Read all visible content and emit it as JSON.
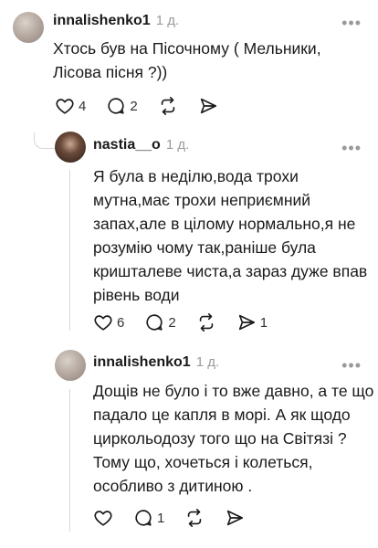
{
  "comments": [
    {
      "user": "innalishenko1",
      "time": "1 д.",
      "text_lines": [
        "Хтось був на Пісочному ( Мельники,",
        "Лісова пісня ?))"
      ],
      "likes": "4",
      "replies": "2",
      "shares": ""
    },
    {
      "user": "nastia__o",
      "time": "1 д.",
      "text_lines": [
        "Я була в неділю,вода трохи",
        "мутна,має трохи неприємний",
        "запах,але в цілому нормально,я не",
        "розумію чому так,раніше була",
        "кришталеве чиста,а зараз дуже впав",
        "рівень води"
      ],
      "likes": "6",
      "replies": "2",
      "shares": "1"
    },
    {
      "user": "innalishenko1",
      "time": "1 д.",
      "text_lines": [
        "Дощів не було і то вже давно, а те що",
        "падало це капля в морі. А як щодо",
        "циркольодозу того що на Світязі ?",
        "Тому що, хочеться і колеться,",
        "особливо з дитиною ."
      ],
      "likes": "",
      "replies": "1",
      "shares": ""
    }
  ],
  "icons": {
    "like": "heart-icon",
    "reply": "comment-icon",
    "repost": "repost-icon",
    "share": "share-icon",
    "more": "more-icon"
  },
  "colors": {
    "muted": "#9a9a9a",
    "thread_line": "#d7d7d7"
  }
}
